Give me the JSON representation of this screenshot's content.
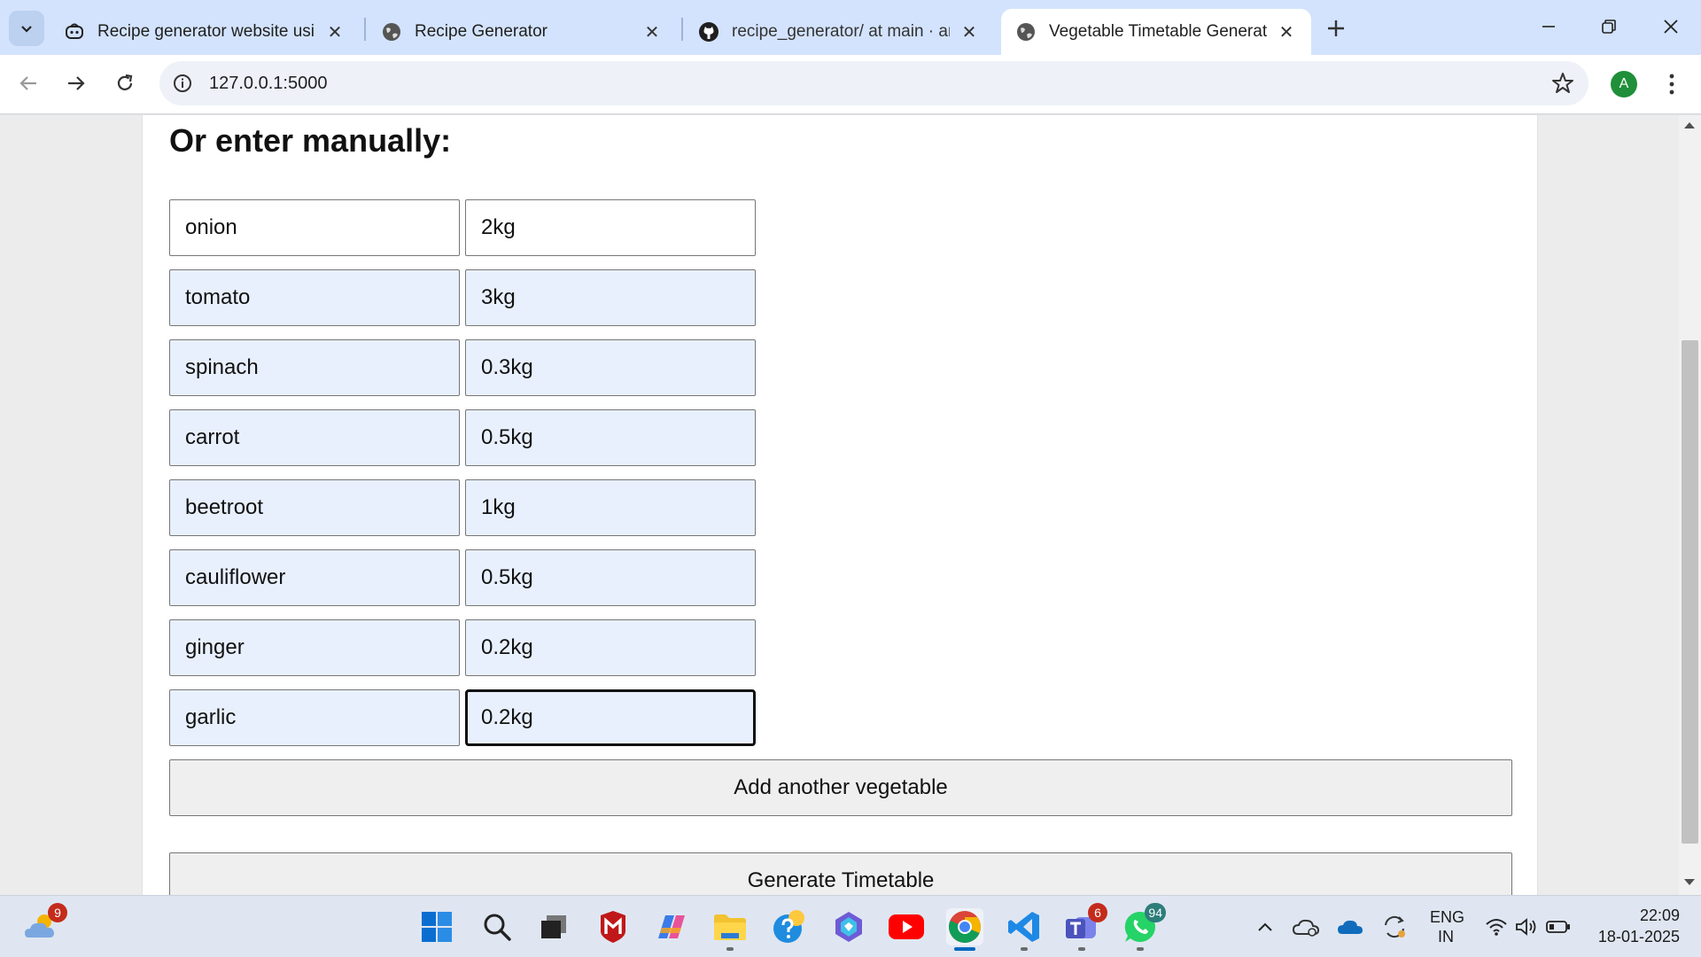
{
  "browser": {
    "tabs": [
      {
        "title": "Recipe generator website using",
        "icon": "copilot-icon",
        "active": false
      },
      {
        "title": "Recipe Generator",
        "icon": "globe-icon",
        "active": false
      },
      {
        "title": "recipe_generator/ at main · anis",
        "icon": "github-icon",
        "active": false
      },
      {
        "title": "Vegetable Timetable Generator",
        "icon": "globe-icon",
        "active": true
      }
    ],
    "url": "127.0.0.1:5000",
    "profile_initial": "A"
  },
  "page": {
    "heading": "Or enter manually:",
    "vegetables": [
      {
        "name": "onion",
        "quantity": "2kg"
      },
      {
        "name": "tomato",
        "quantity": "3kg"
      },
      {
        "name": "spinach",
        "quantity": "0.3kg"
      },
      {
        "name": "carrot",
        "quantity": "0.5kg"
      },
      {
        "name": "beetroot",
        "quantity": "1kg"
      },
      {
        "name": "cauliflower",
        "quantity": "0.5kg"
      },
      {
        "name": "ginger",
        "quantity": "0.2kg"
      },
      {
        "name": "garlic",
        "quantity": "0.2kg"
      }
    ],
    "add_button": "Add another vegetable",
    "generate_button": "Generate Timetable"
  },
  "taskbar": {
    "weather_badge": "9",
    "teams_badge": "6",
    "whatsapp_badge": "94",
    "language_line1": "ENG",
    "language_line2": "IN",
    "time": "22:09",
    "date": "18-01-2025"
  },
  "colors": {
    "autofill_bg": "#e8f0fe",
    "tabstrip_bg": "#d3e3fd",
    "taskbar_bg": "#dfe6f1"
  }
}
